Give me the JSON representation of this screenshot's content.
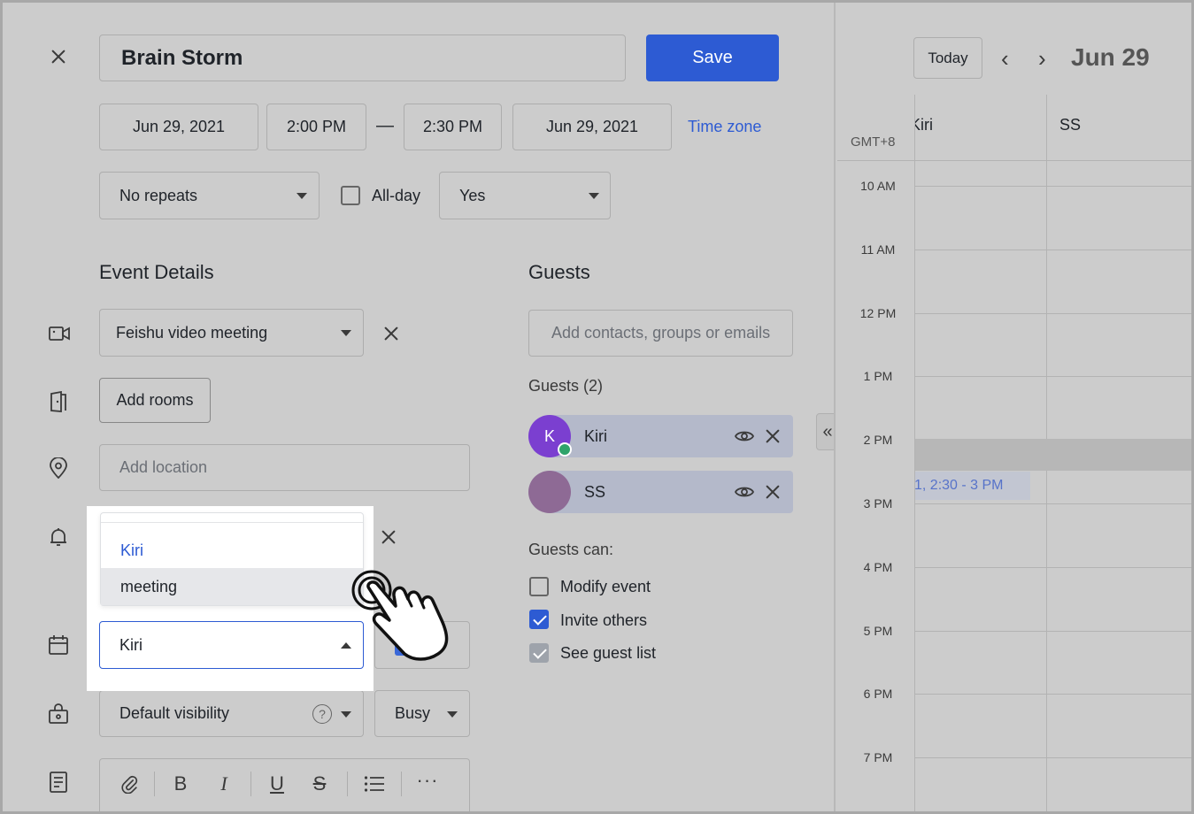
{
  "header": {
    "title_value": "Brain Storm",
    "save_label": "Save"
  },
  "datetime": {
    "start_date": "Jun 29, 2021",
    "start_time": "2:00 PM",
    "dash": "—",
    "end_time": "2:30 PM",
    "end_date": "Jun 29, 2021",
    "timezone_label": "Time zone"
  },
  "options": {
    "repeat_value": "No repeats",
    "allday_label": "All-day",
    "yes_value": "Yes"
  },
  "event_details": {
    "heading": "Event Details",
    "video_meeting_value": "Feishu video meeting",
    "add_rooms_label": "Add rooms",
    "location_placeholder": "Add location",
    "calendar_value": "Kiri",
    "dropdown_options": [
      "Kiri",
      "meeting"
    ],
    "visibility_value": "Default visibility",
    "busy_value": "Busy"
  },
  "guests": {
    "heading": "Guests",
    "add_placeholder": "Add contacts, groups or emails",
    "count_label": "Guests (2)",
    "list": [
      {
        "name": "Kiri",
        "initial": "K",
        "avatar_color": "#7b3fd0"
      },
      {
        "name": "SS",
        "initial": "",
        "avatar_color": "#8e6a95"
      }
    ],
    "can_label": "Guests can:",
    "permissions": [
      {
        "label": "Modify event",
        "state": "unchecked"
      },
      {
        "label": "Invite others",
        "state": "checked"
      },
      {
        "label": "See guest list",
        "state": "disabled"
      }
    ]
  },
  "calendar": {
    "today_label": "Today",
    "date_label": "Jun 29",
    "timezone": "GMT+8",
    "columns": [
      "Kiri",
      "SS"
    ],
    "hours": [
      "10 AM",
      "11 AM",
      "12 PM",
      "1 PM",
      "2 PM",
      "3 PM",
      "4 PM",
      "5 PM",
      "6 PM",
      "7 PM"
    ],
    "event_label": "1, 2:30 - 3 PM"
  },
  "colors": {
    "accent": "#2d5bd3",
    "link": "#2d5bd3"
  }
}
